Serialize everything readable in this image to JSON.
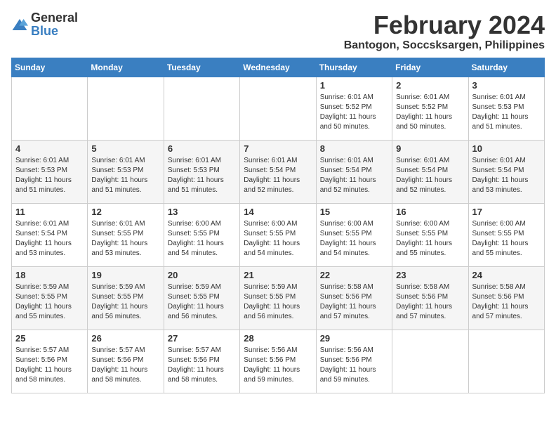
{
  "logo": {
    "text_general": "General",
    "text_blue": "Blue"
  },
  "header": {
    "title": "February 2024",
    "subtitle": "Bantogon, Soccsksargen, Philippines"
  },
  "calendar": {
    "days_of_week": [
      "Sunday",
      "Monday",
      "Tuesday",
      "Wednesday",
      "Thursday",
      "Friday",
      "Saturday"
    ],
    "weeks": [
      [
        {
          "day": "",
          "sunrise": "",
          "sunset": "",
          "daylight": ""
        },
        {
          "day": "",
          "sunrise": "",
          "sunset": "",
          "daylight": ""
        },
        {
          "day": "",
          "sunrise": "",
          "sunset": "",
          "daylight": ""
        },
        {
          "day": "",
          "sunrise": "",
          "sunset": "",
          "daylight": ""
        },
        {
          "day": "1",
          "sunrise": "Sunrise: 6:01 AM",
          "sunset": "Sunset: 5:52 PM",
          "daylight": "Daylight: 11 hours and 50 minutes."
        },
        {
          "day": "2",
          "sunrise": "Sunrise: 6:01 AM",
          "sunset": "Sunset: 5:52 PM",
          "daylight": "Daylight: 11 hours and 50 minutes."
        },
        {
          "day": "3",
          "sunrise": "Sunrise: 6:01 AM",
          "sunset": "Sunset: 5:53 PM",
          "daylight": "Daylight: 11 hours and 51 minutes."
        }
      ],
      [
        {
          "day": "4",
          "sunrise": "Sunrise: 6:01 AM",
          "sunset": "Sunset: 5:53 PM",
          "daylight": "Daylight: 11 hours and 51 minutes."
        },
        {
          "day": "5",
          "sunrise": "Sunrise: 6:01 AM",
          "sunset": "Sunset: 5:53 PM",
          "daylight": "Daylight: 11 hours and 51 minutes."
        },
        {
          "day": "6",
          "sunrise": "Sunrise: 6:01 AM",
          "sunset": "Sunset: 5:53 PM",
          "daylight": "Daylight: 11 hours and 51 minutes."
        },
        {
          "day": "7",
          "sunrise": "Sunrise: 6:01 AM",
          "sunset": "Sunset: 5:54 PM",
          "daylight": "Daylight: 11 hours and 52 minutes."
        },
        {
          "day": "8",
          "sunrise": "Sunrise: 6:01 AM",
          "sunset": "Sunset: 5:54 PM",
          "daylight": "Daylight: 11 hours and 52 minutes."
        },
        {
          "day": "9",
          "sunrise": "Sunrise: 6:01 AM",
          "sunset": "Sunset: 5:54 PM",
          "daylight": "Daylight: 11 hours and 52 minutes."
        },
        {
          "day": "10",
          "sunrise": "Sunrise: 6:01 AM",
          "sunset": "Sunset: 5:54 PM",
          "daylight": "Daylight: 11 hours and 53 minutes."
        }
      ],
      [
        {
          "day": "11",
          "sunrise": "Sunrise: 6:01 AM",
          "sunset": "Sunset: 5:54 PM",
          "daylight": "Daylight: 11 hours and 53 minutes."
        },
        {
          "day": "12",
          "sunrise": "Sunrise: 6:01 AM",
          "sunset": "Sunset: 5:55 PM",
          "daylight": "Daylight: 11 hours and 53 minutes."
        },
        {
          "day": "13",
          "sunrise": "Sunrise: 6:00 AM",
          "sunset": "Sunset: 5:55 PM",
          "daylight": "Daylight: 11 hours and 54 minutes."
        },
        {
          "day": "14",
          "sunrise": "Sunrise: 6:00 AM",
          "sunset": "Sunset: 5:55 PM",
          "daylight": "Daylight: 11 hours and 54 minutes."
        },
        {
          "day": "15",
          "sunrise": "Sunrise: 6:00 AM",
          "sunset": "Sunset: 5:55 PM",
          "daylight": "Daylight: 11 hours and 54 minutes."
        },
        {
          "day": "16",
          "sunrise": "Sunrise: 6:00 AM",
          "sunset": "Sunset: 5:55 PM",
          "daylight": "Daylight: 11 hours and 55 minutes."
        },
        {
          "day": "17",
          "sunrise": "Sunrise: 6:00 AM",
          "sunset": "Sunset: 5:55 PM",
          "daylight": "Daylight: 11 hours and 55 minutes."
        }
      ],
      [
        {
          "day": "18",
          "sunrise": "Sunrise: 5:59 AM",
          "sunset": "Sunset: 5:55 PM",
          "daylight": "Daylight: 11 hours and 55 minutes."
        },
        {
          "day": "19",
          "sunrise": "Sunrise: 5:59 AM",
          "sunset": "Sunset: 5:55 PM",
          "daylight": "Daylight: 11 hours and 56 minutes."
        },
        {
          "day": "20",
          "sunrise": "Sunrise: 5:59 AM",
          "sunset": "Sunset: 5:55 PM",
          "daylight": "Daylight: 11 hours and 56 minutes."
        },
        {
          "day": "21",
          "sunrise": "Sunrise: 5:59 AM",
          "sunset": "Sunset: 5:55 PM",
          "daylight": "Daylight: 11 hours and 56 minutes."
        },
        {
          "day": "22",
          "sunrise": "Sunrise: 5:58 AM",
          "sunset": "Sunset: 5:56 PM",
          "daylight": "Daylight: 11 hours and 57 minutes."
        },
        {
          "day": "23",
          "sunrise": "Sunrise: 5:58 AM",
          "sunset": "Sunset: 5:56 PM",
          "daylight": "Daylight: 11 hours and 57 minutes."
        },
        {
          "day": "24",
          "sunrise": "Sunrise: 5:58 AM",
          "sunset": "Sunset: 5:56 PM",
          "daylight": "Daylight: 11 hours and 57 minutes."
        }
      ],
      [
        {
          "day": "25",
          "sunrise": "Sunrise: 5:57 AM",
          "sunset": "Sunset: 5:56 PM",
          "daylight": "Daylight: 11 hours and 58 minutes."
        },
        {
          "day": "26",
          "sunrise": "Sunrise: 5:57 AM",
          "sunset": "Sunset: 5:56 PM",
          "daylight": "Daylight: 11 hours and 58 minutes."
        },
        {
          "day": "27",
          "sunrise": "Sunrise: 5:57 AM",
          "sunset": "Sunset: 5:56 PM",
          "daylight": "Daylight: 11 hours and 58 minutes."
        },
        {
          "day": "28",
          "sunrise": "Sunrise: 5:56 AM",
          "sunset": "Sunset: 5:56 PM",
          "daylight": "Daylight: 11 hours and 59 minutes."
        },
        {
          "day": "29",
          "sunrise": "Sunrise: 5:56 AM",
          "sunset": "Sunset: 5:56 PM",
          "daylight": "Daylight: 11 hours and 59 minutes."
        },
        {
          "day": "",
          "sunrise": "",
          "sunset": "",
          "daylight": ""
        },
        {
          "day": "",
          "sunrise": "",
          "sunset": "",
          "daylight": ""
        }
      ]
    ]
  }
}
